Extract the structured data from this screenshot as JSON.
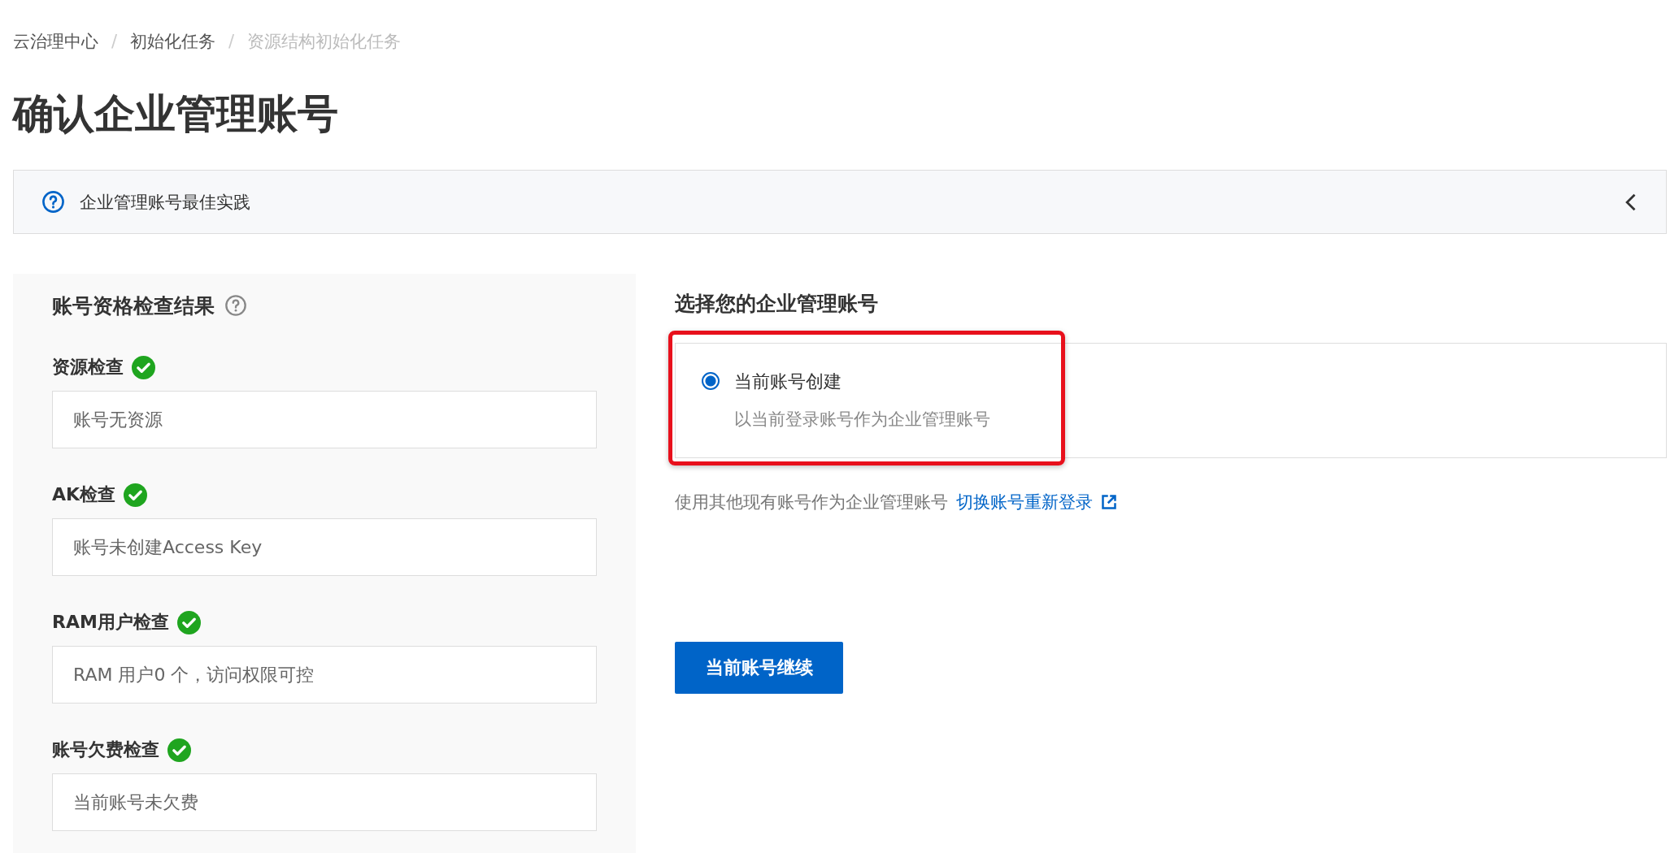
{
  "breadcrumb": [
    {
      "label": "云治理中心",
      "current": false
    },
    {
      "label": "初始化任务",
      "current": false
    },
    {
      "label": "资源结构初始化任务",
      "current": true
    }
  ],
  "breadcrumb_separator": "/",
  "title": "确认企业管理账号",
  "banner": {
    "text": "企业管理账号最佳实践",
    "expanded": false
  },
  "check_panel": {
    "title": "账号资格检查结果",
    "checks": [
      {
        "label": "资源检查",
        "passed": true,
        "value": "账号无资源"
      },
      {
        "label": "AK检查",
        "passed": true,
        "value": "账号未创建Access Key"
      },
      {
        "label": "RAM用户检查",
        "passed": true,
        "value": "RAM 用户0 个，访问权限可控"
      },
      {
        "label": "账号欠费检查",
        "passed": true,
        "value": "当前账号未欠费"
      }
    ]
  },
  "account_choice": {
    "title": "选择您的企业管理账号",
    "options": [
      {
        "label": "当前账号创建",
        "description": "以当前登录账号作为企业管理账号",
        "selected": true,
        "highlighted": true
      }
    ],
    "hint": "使用其他现有账号作为企业管理账号",
    "link": "切换账号重新登录",
    "button": "当前账号继续"
  }
}
